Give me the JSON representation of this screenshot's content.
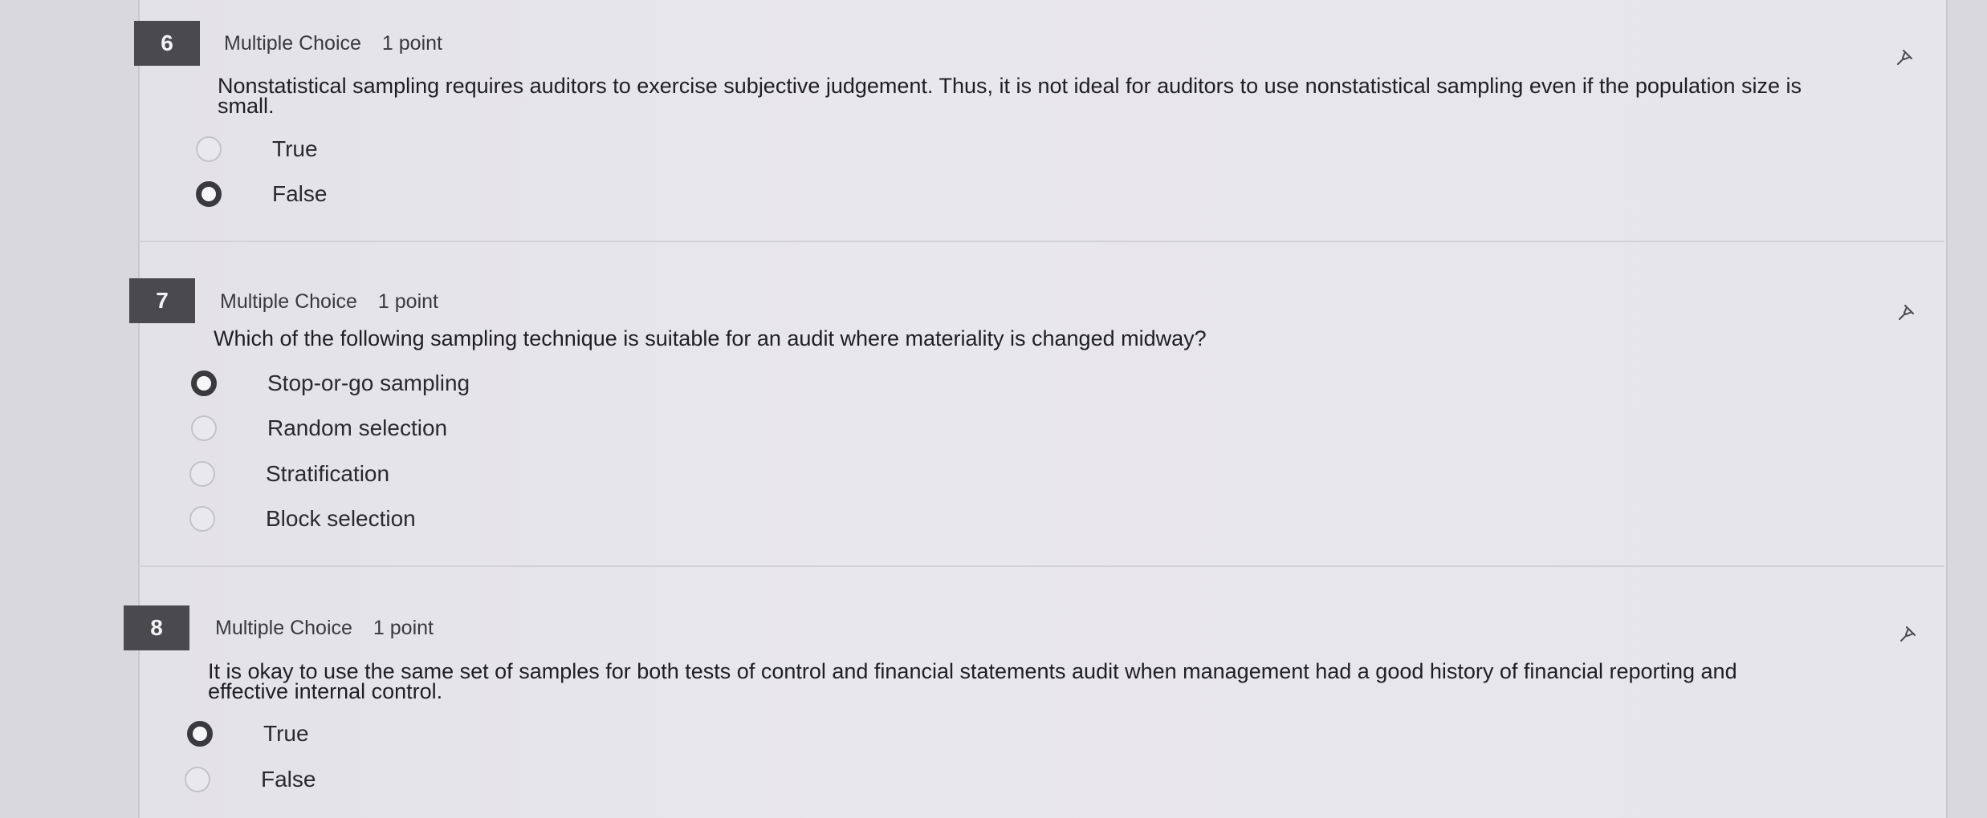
{
  "questions": [
    {
      "number": "6",
      "type": "Multiple Choice",
      "points": "1 point",
      "text_line1": "Nonstatistical sampling requires auditors to exercise subjective judgement. Thus, it is not ideal for auditors to use nonstatistical sampling even if the population size is",
      "text_line2": "small.",
      "options": [
        {
          "label": "True",
          "selected": false
        },
        {
          "label": "False",
          "selected": true
        }
      ]
    },
    {
      "number": "7",
      "type": "Multiple Choice",
      "points": "1 point",
      "text_line1": "Which of the following sampling technique is suitable for an audit where materiality is changed midway?",
      "options": [
        {
          "label": "Stop-or-go sampling",
          "selected": true
        },
        {
          "label": "Random selection",
          "selected": false
        },
        {
          "label": "Stratification",
          "selected": false
        },
        {
          "label": "Block selection",
          "selected": false
        }
      ]
    },
    {
      "number": "8",
      "type": "Multiple Choice",
      "points": "1 point",
      "text_line1": "It is okay to use the same set of samples for both tests of control and financial statements audit when management had a good history of financial reporting and",
      "text_line2": "effective internal control.",
      "options": [
        {
          "label": "True",
          "selected": true
        },
        {
          "label": "False",
          "selected": false
        }
      ]
    }
  ],
  "icons": {
    "pin": "pin-icon"
  },
  "colors": {
    "number_box": "#4a4a4e",
    "radio_selected": "#3a3a3e"
  }
}
